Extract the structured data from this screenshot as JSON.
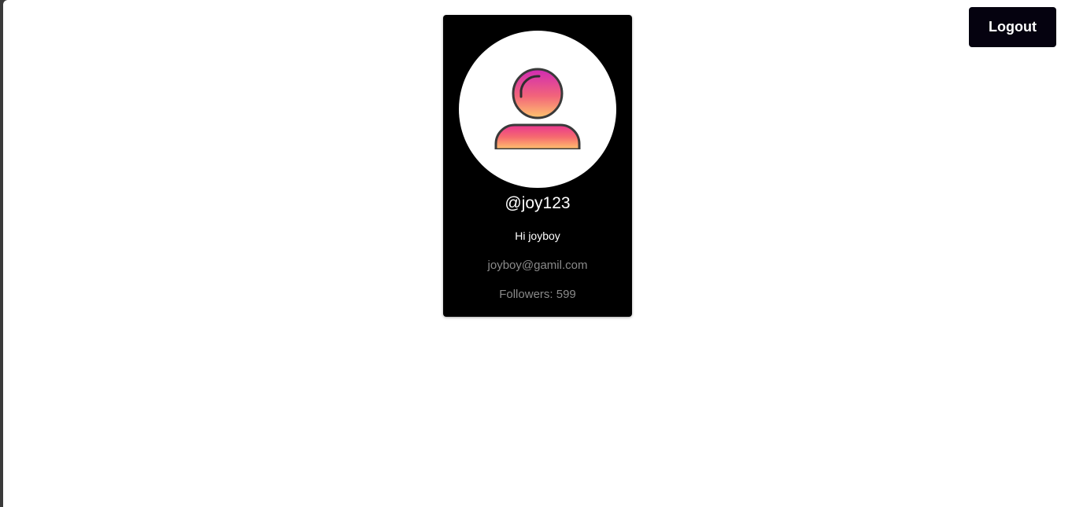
{
  "header": {
    "logout_label": "Logout"
  },
  "profile": {
    "avatar_icon": "user-icon",
    "username": "@joy123",
    "bio": "Hi joyboy",
    "email": "joyboy@gamil.com",
    "followers_text": "Followers: 599"
  },
  "colors": {
    "card_background": "#000000",
    "logout_background": "#05020f",
    "avatar_gradient_top": "#d02ab4",
    "avatar_gradient_mid": "#f2647a",
    "avatar_gradient_bottom": "#ffc46e",
    "muted_text": "#8a8a8a"
  }
}
